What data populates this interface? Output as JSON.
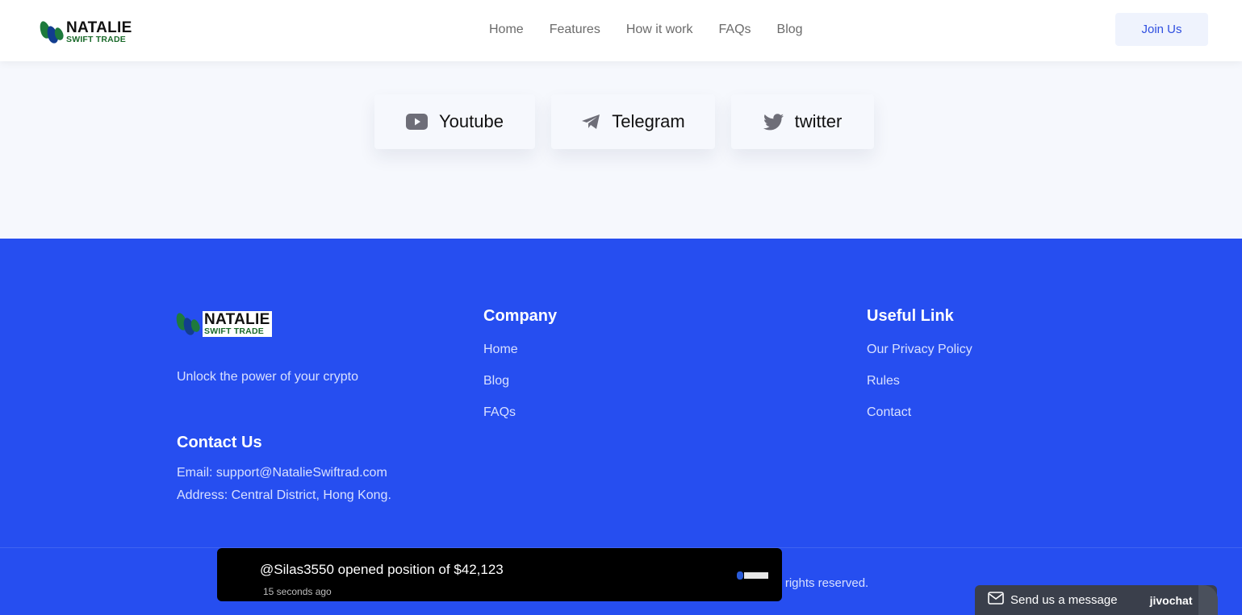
{
  "header": {
    "logo": {
      "line1": "NATALIE",
      "line2": "SWIFT TRADE"
    },
    "nav": [
      "Home",
      "Features",
      "How it work",
      "FAQs",
      "Blog"
    ],
    "join_label": "Join Us"
  },
  "social": [
    {
      "label": "Youtube",
      "icon": "youtube-icon"
    },
    {
      "label": "Telegram",
      "icon": "telegram-icon"
    },
    {
      "label": "twitter",
      "icon": "twitter-icon"
    }
  ],
  "footer": {
    "logo": {
      "line1": "NATALIE",
      "line2": "SWIFT TRADE"
    },
    "tagline": "Unlock the power of your crypto",
    "contact_heading": "Contact Us",
    "email": "Email: support@NatalieSwiftrad.com",
    "address": "Address: Central District, Hong Kong.",
    "company_heading": "Company",
    "company_links": [
      "Home",
      "Blog",
      "FAQs"
    ],
    "useful_heading": "Useful Link",
    "useful_links": [
      "Our Privacy Policy",
      "Rules",
      "Contact"
    ],
    "copyright_partial": "ll rights reserved."
  },
  "toast": {
    "message": "@Silas3550 opened position of $42,123",
    "time": "15 seconds ago"
  },
  "chat": {
    "label": "Send us a message",
    "brand": "jivochat"
  },
  "colors": {
    "footer_bg": "#264ef0",
    "accent": "#2f4fe0",
    "section_bg": "#f6f8fd"
  }
}
